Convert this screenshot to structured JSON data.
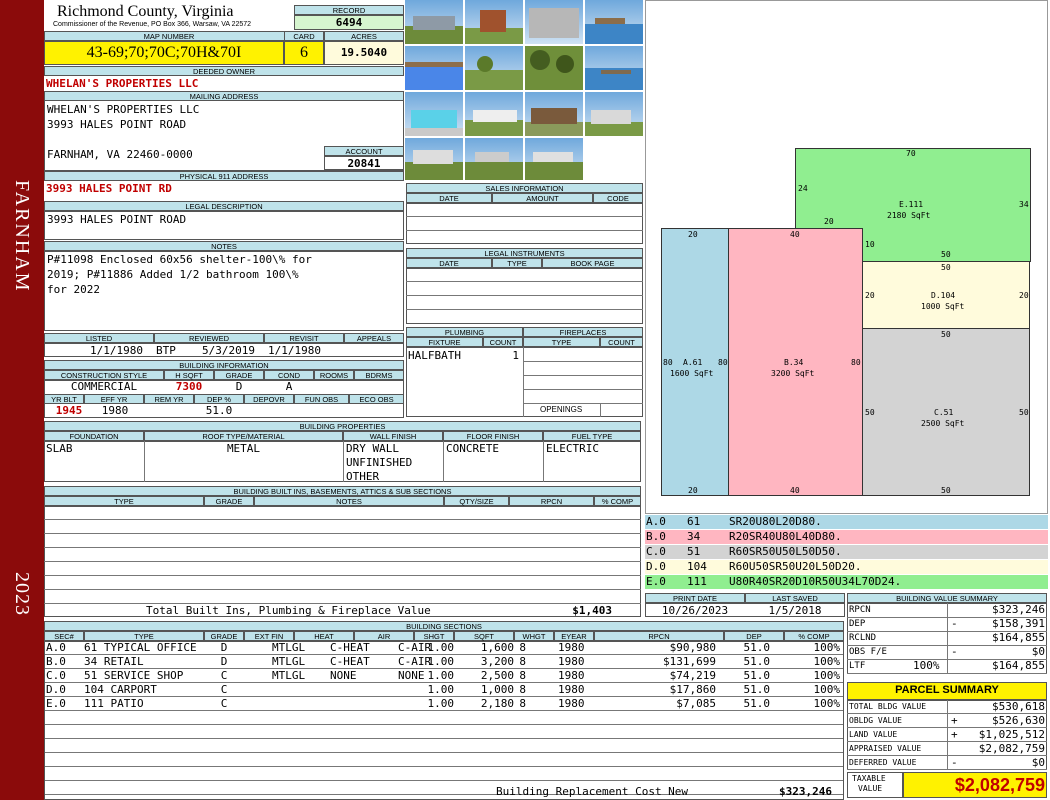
{
  "sidebar": {
    "city": "FARNHAM",
    "year": "2023"
  },
  "header": {
    "county": "Richmond County, Virginia",
    "commissioner": "Commissioner of the Revenue, PO Box 366, Warsaw, VA 22572"
  },
  "record": {
    "label": "RECORD",
    "value": "6494"
  },
  "map": {
    "label": "MAP NUMBER",
    "value": "43-69;70;70C;70H&70I"
  },
  "card": {
    "label": "CARD",
    "value": "6"
  },
  "acres": {
    "label": "ACRES",
    "value": "19.5040"
  },
  "owner": {
    "label": "DEEDED OWNER",
    "value": "WHELAN'S PROPERTIES LLC"
  },
  "mailing": {
    "label": "MAILING ADDRESS",
    "line1": "WHELAN'S PROPERTIES LLC",
    "line2": "3993 HALES POINT ROAD",
    "line3": "FARNHAM, VA 22460-0000"
  },
  "account": {
    "label": "ACCOUNT",
    "value": "20841"
  },
  "physical": {
    "label": "PHYSICAL 911 ADDRESS",
    "value": "3993 HALES POINT RD"
  },
  "legal": {
    "label": "LEGAL DESCRIPTION",
    "value": "3993 HALES POINT ROAD"
  },
  "notes": {
    "label": "NOTES",
    "line1": "P#11098 Enclosed 60x56 shelter-100\\% for",
    "line2": "2019; P#11886 Added 1/2 bathroom 100\\%",
    "line3": "for 2022"
  },
  "dates": {
    "listed_label": "LISTED",
    "listed": "1/1/1980",
    "reviewed_label": "REVIEWED",
    "reviewed_by": "BTP",
    "reviewed": "5/3/2019",
    "revisit_label": "REVISIT",
    "revisit": "1/1/1980",
    "appeals_label": "APPEALS"
  },
  "building_info": {
    "label": "BUILDING INFORMATION",
    "h_style": "CONSTRUCTION STYLE",
    "h_sqft": "H SQFT",
    "h_grade": "GRADE",
    "h_cond": "COND",
    "h_rooms": "ROOMS",
    "h_bdrms": "BDRMS",
    "style": "COMMERCIAL",
    "sqft": "7300",
    "grade": "D",
    "cond": "A",
    "h_yrblt": "YR BLT",
    "h_effyr": "EFF YR",
    "h_remyr": "REM YR",
    "h_dep": "DEP %",
    "h_depovr": "DEPOVR",
    "h_funobs": "FUN OBS",
    "h_ecoobs": "ECO OBS",
    "yrblt": "1945",
    "effyr": "1980",
    "dep": "51.0"
  },
  "sales": {
    "label": "SALES INFORMATION",
    "h_date": "DATE",
    "h_amount": "AMOUNT",
    "h_code": "CODE"
  },
  "legal_instruments": {
    "label": "LEGAL INSTRUMENTS",
    "h_date": "DATE",
    "h_type": "TYPE",
    "h_book": "BOOK PAGE"
  },
  "plumbing": {
    "label": "PLUMBING",
    "h_fixture": "FIXTURE",
    "h_count": "COUNT",
    "fixture": "HALFBATH",
    "count": "1"
  },
  "fireplaces": {
    "label": "FIREPLACES",
    "h_type": "TYPE",
    "h_count": "COUNT",
    "openings": "OPENINGS"
  },
  "properties": {
    "label": "BUILDING PROPERTIES",
    "h_foundation": "FOUNDATION",
    "h_roof": "ROOF TYPE/MATERIAL",
    "h_wall": "WALL FINISH",
    "h_floor": "FLOOR FINISH",
    "h_fuel": "FUEL TYPE",
    "foundation": "SLAB",
    "roof": "METAL",
    "wall1": "DRY WALL",
    "wall2": "UNFINISHED",
    "wall3": "OTHER",
    "floor": "CONCRETE",
    "fuel": "ELECTRIC"
  },
  "builtins": {
    "label": "BUILDING BUILT INS, BASEMENTS, ATTICS & SUB SECTIONS",
    "h_type": "TYPE",
    "h_grade": "GRADE",
    "h_notes": "NOTES",
    "h_qty": "QTY/SIZE",
    "h_rpcn": "RPCN",
    "h_comp": "% COMP",
    "total_label": "Total Built Ins, Plumbing & Fireplace Value",
    "total": "$1,403"
  },
  "print": {
    "print_label": "PRINT DATE",
    "print_date": "10/26/2023",
    "saved_label": "LAST SAVED",
    "saved_date": "1/5/2018"
  },
  "sections": {
    "label": "BUILDING SECTIONS",
    "headers": [
      "SEC#",
      "TYPE",
      "GRADE",
      "EXT FIN",
      "HEAT",
      "AIR",
      "SHGT",
      "SQFT",
      "WHGT",
      "EYEAR",
      "RPCN",
      "DEP",
      "% COMP"
    ],
    "rows": [
      [
        "A.0",
        "61 TYPICAL OFFICE",
        "D",
        "MTLGL",
        "C-HEAT",
        "C-AIR",
        "1.00",
        "1,600",
        "8",
        "1980",
        "$90,980",
        "51.0",
        "100%"
      ],
      [
        "B.0",
        "34 RETAIL",
        "D",
        "MTLGL",
        "C-HEAT",
        "C-AIR",
        "1.00",
        "3,200",
        "8",
        "1980",
        "$131,699",
        "51.0",
        "100%"
      ],
      [
        "C.0",
        "51 SERVICE SHOP",
        "C",
        "MTLGL",
        "NONE",
        "NONE",
        "1.00",
        "2,500",
        "8",
        "1980",
        "$74,219",
        "51.0",
        "100%"
      ],
      [
        "D.0",
        "104 CARPORT",
        "C",
        "",
        "",
        "",
        "1.00",
        "1,000",
        "8",
        "1980",
        "$17,860",
        "51.0",
        "100%"
      ],
      [
        "E.0",
        "111 PATIO",
        "C",
        "",
        "",
        "",
        "1.00",
        "2,180",
        "8",
        "1980",
        "$7,085",
        "51.0",
        "100%"
      ]
    ],
    "total_label": "Building Replacement Cost New",
    "total": "$323,246"
  },
  "legend": [
    {
      "sec": "A.0",
      "code": "61",
      "path": "SR20U80L20D80.",
      "color": "#add8e6"
    },
    {
      "sec": "B.0",
      "code": "34",
      "path": "R20SR40U80L40D80.",
      "color": "#ffb6c1"
    },
    {
      "sec": "C.0",
      "code": "51",
      "path": "R60SR50U50L50D50.",
      "color": "#d3d3d3"
    },
    {
      "sec": "D.0",
      "code": "104",
      "path": "R60U50SR50U20L50D20.",
      "color": "#fffbdc"
    },
    {
      "sec": "E.0",
      "code": "111",
      "path": "U80R40SR20D10R50U34L70D24.",
      "color": "#90ee90"
    }
  ],
  "sketch": {
    "A": {
      "name": "A.61",
      "area": "1600 SqFt",
      "top": "20",
      "bottom": "20",
      "left": "80",
      "right": "80"
    },
    "B": {
      "name": "B.34",
      "area": "3200 SqFt",
      "top": "40",
      "bottom": "40",
      "right": "80"
    },
    "C": {
      "name": "C.51",
      "area": "2500 SqFt",
      "top": "50",
      "bottom": "50",
      "left": "50",
      "right": "50"
    },
    "D": {
      "name": "D.104",
      "area": "1000 SqFt",
      "top": "50",
      "left": "20",
      "right": "20"
    },
    "E": {
      "name": "E.111",
      "area": "2180 SqFt",
      "top": "70",
      "left": "24",
      "right": "34",
      "inner_top": "20",
      "inner_left": "10",
      "bottom": "50"
    }
  },
  "bvs": {
    "label": "BUILDING VALUE SUMMARY",
    "rpcn_label": "RPCN",
    "rpcn": "$323,246",
    "dep_label": "DEP",
    "dep_sign": "-",
    "dep": "$158,391",
    "rclnd_label": "RCLND",
    "rclnd": "$164,855",
    "obs_label": "OBS F/E",
    "obs_sign": "-",
    "obs": "$0",
    "ltf_label": "LTF",
    "ltf_pct": "100%",
    "ltf": "$164,855"
  },
  "parcel": {
    "label": "PARCEL SUMMARY",
    "total_bldg_label": "TOTAL BLDG VALUE",
    "total_bldg": "$530,618",
    "obldg_label": "OBLDG VALUE",
    "obldg_sign": "+",
    "obldg": "$526,630",
    "land_label": "LAND VALUE",
    "land_sign": "+",
    "land": "$1,025,512",
    "appraised_label": "APPRAISED VALUE",
    "appraised": "$2,082,759",
    "deferred_label": "DEFERRED VALUE",
    "deferred_sign": "-",
    "deferred": "$0",
    "taxable_label1": "TAXABLE",
    "taxable_label2": "VALUE",
    "taxable": "$2,082,759"
  }
}
